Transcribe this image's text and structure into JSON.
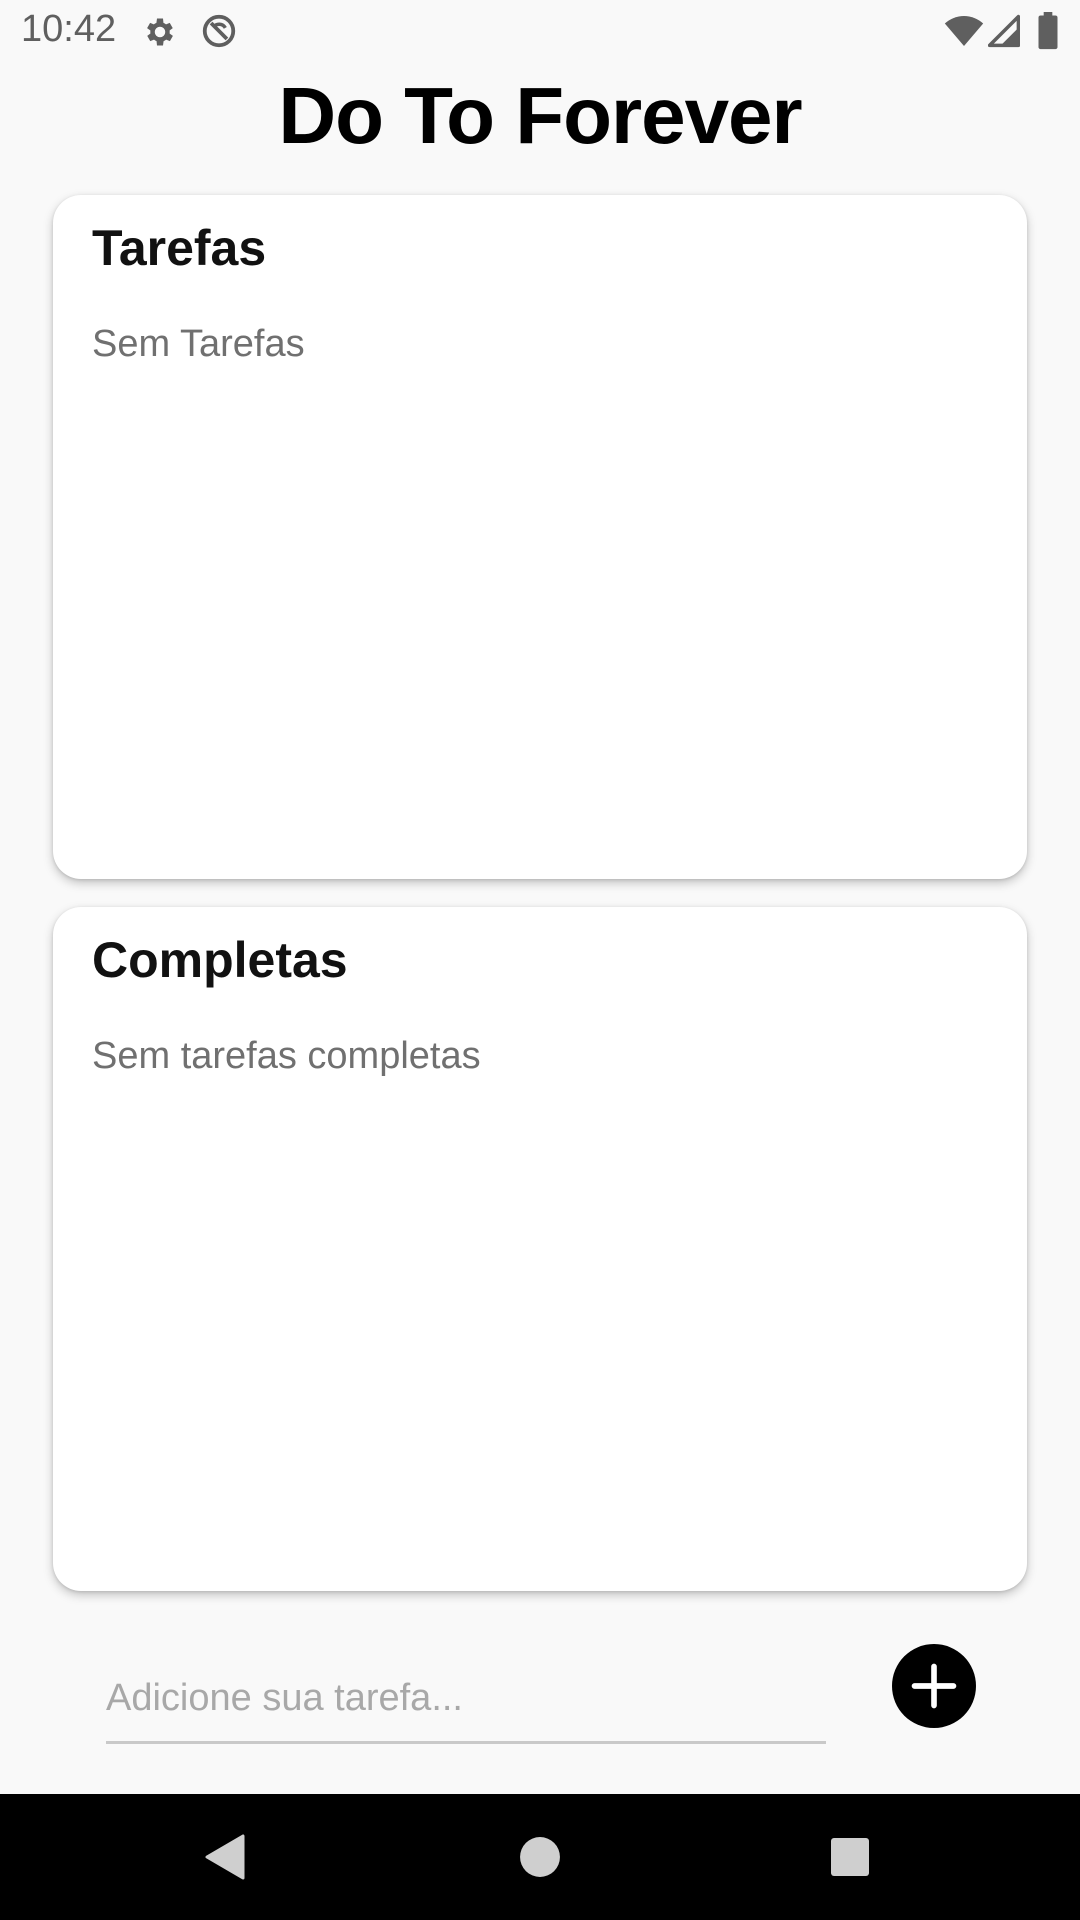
{
  "status_bar": {
    "time": "10:42",
    "icons": [
      "gear-icon",
      "no-sync-icon",
      "wifi-icon",
      "signal-icon",
      "battery-icon"
    ]
  },
  "app": {
    "title": "Do To Forever"
  },
  "tasks_card": {
    "title": "Tarefas",
    "empty_text": "Sem Tarefas"
  },
  "completed_card": {
    "title": "Completas",
    "empty_text": "Sem tarefas completas"
  },
  "new_task": {
    "placeholder": "Adicione sua tarefa...",
    "value": "",
    "add_icon": "plus-icon"
  },
  "nav_bar": {
    "icons": [
      "back-icon",
      "home-icon",
      "recents-icon"
    ]
  },
  "colors": {
    "background": "#f9f9f9",
    "card": "#ffffff",
    "accent": "#000000",
    "muted_text": "#707070"
  }
}
